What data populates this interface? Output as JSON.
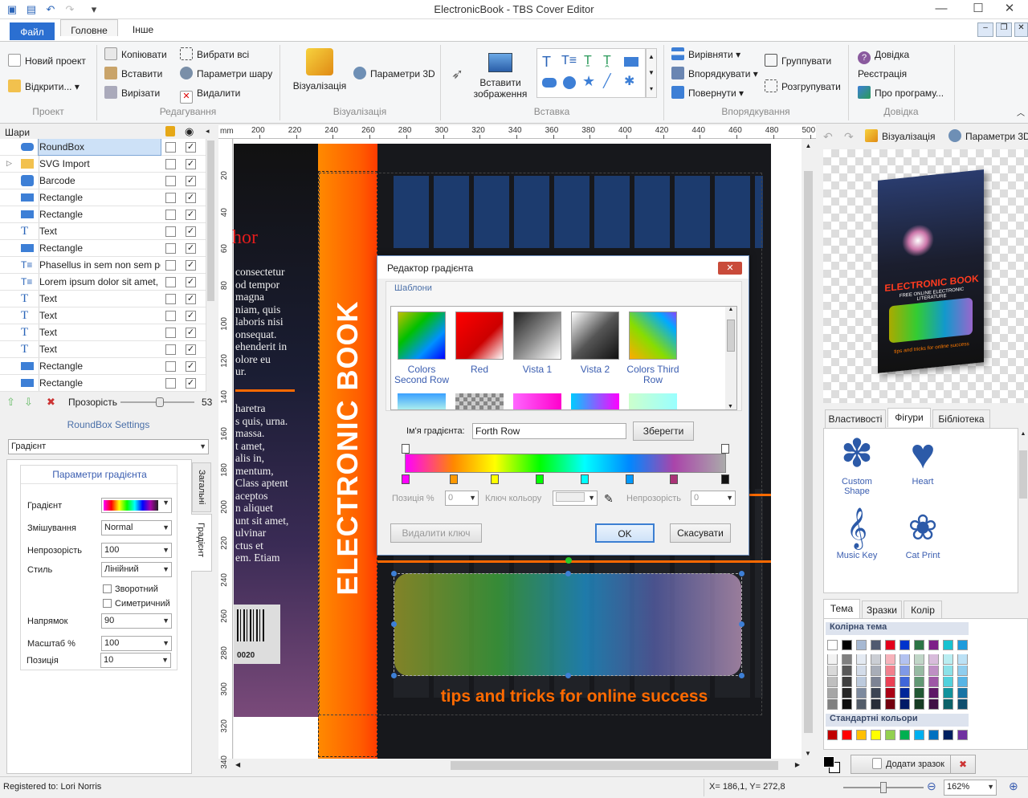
{
  "app": {
    "title": "ElectronicBook - TBS Cover Editor"
  },
  "ribbon_tabs": [
    "Файл",
    "Головне",
    "Інше"
  ],
  "ribbon": {
    "project": {
      "label": "Проект",
      "new": "Новий проект",
      "open": "Відкрити..."
    },
    "edit": {
      "label": "Редагування",
      "copy": "Копіювати",
      "paste": "Вставити",
      "cut": "Вирізати",
      "select_all": "Вибрати всі",
      "layer_params": "Параметри шару",
      "delete": "Видалити"
    },
    "visual": {
      "label": "Візуалізація",
      "visualize": "Візуалізація",
      "params3d": "Параметри 3D"
    },
    "insert": {
      "label": "Вставка",
      "insert_image": "Вставити зображення"
    },
    "arrange": {
      "label": "Впорядкування",
      "align": "Вирівняти",
      "order": "Впорядкувати",
      "rotate": "Повернути",
      "group": "Группувати",
      "ungroup": "Розгрупувати"
    },
    "help": {
      "label": "Довідка",
      "help": "Довідка",
      "register": "Реєстрація",
      "about": "Про програму..."
    }
  },
  "layers": {
    "title": "Шари",
    "items": [
      {
        "name": "RoundBox",
        "icon": "roundbox-icon",
        "selected": true
      },
      {
        "name": "SVG Import",
        "icon": "folder-icon",
        "selected": false
      },
      {
        "name": "Barcode",
        "icon": "puzzle-icon",
        "selected": false
      },
      {
        "name": "Rectangle",
        "icon": "rectangle-icon",
        "selected": false
      },
      {
        "name": "Rectangle",
        "icon": "rectangle-icon",
        "selected": false
      },
      {
        "name": "Text",
        "icon": "text-icon",
        "selected": false
      },
      {
        "name": "Rectangle",
        "icon": "rectangle-icon",
        "selected": false
      },
      {
        "name": "Phasellus in sem non sem porta",
        "icon": "paragraph-icon",
        "selected": false
      },
      {
        "name": "Lorem ipsum dolor sit amet, cor",
        "icon": "paragraph-icon",
        "selected": false
      },
      {
        "name": "Text",
        "icon": "text-icon",
        "selected": false
      },
      {
        "name": "Text",
        "icon": "text-icon",
        "selected": false
      },
      {
        "name": "Text",
        "icon": "text-icon",
        "selected": false
      },
      {
        "name": "Text",
        "icon": "text-icon",
        "selected": false
      },
      {
        "name": "Rectangle",
        "icon": "rectangle-icon",
        "selected": false
      },
      {
        "name": "Rectangle",
        "icon": "rectangle-icon",
        "selected": false
      }
    ],
    "opacity_label": "Прозорість",
    "opacity_value": "53",
    "opacity_level": 0.53
  },
  "settings": {
    "title": "RoundBox Settings",
    "fill_type": "Градієнт",
    "group_title": "Параметри градієнта",
    "gradient_label": "Градієнт",
    "blend_label": "Змішування",
    "blend_value": "Normal",
    "opacity_label": "Непрозорість",
    "opacity_value": "100",
    "style_label": "Стиль",
    "style_value": "Лінійний",
    "reverse_label": "Зворотний",
    "symmetric_label": "Симетричний",
    "direction_label": "Напрямок",
    "direction_value": "90",
    "scale_label": "Масштаб %",
    "scale_value": "100",
    "position_label": "Позиція",
    "position_value": "10",
    "side_tabs": [
      "Загальні",
      "Градієнт"
    ]
  },
  "ruler": {
    "unit": "mm",
    "top_ticks": [
      "200",
      "220",
      "240",
      "260",
      "280",
      "300",
      "320",
      "340",
      "360",
      "380",
      "400",
      "420",
      "440",
      "460",
      "480",
      "500"
    ],
    "left_ticks": [
      "20",
      "40",
      "60",
      "80",
      "100",
      "120",
      "140",
      "160",
      "180",
      "200",
      "220",
      "240",
      "260",
      "280",
      "300",
      "320",
      "340"
    ]
  },
  "cover": {
    "spine_title": "ELECTRONIC BOOK",
    "author_fragment": "hor",
    "body_text": [
      "consectetur",
      "od tempor",
      "magna",
      "niam, quis",
      "laboris nisi",
      "onsequat.",
      "ehenderit in",
      "olore eu",
      "ur."
    ],
    "body_text2": [
      "haretra",
      "s quis, urna.",
      "massa.",
      "t amet,",
      "alis in,",
      "mentum,",
      "Class aptent",
      "aceptos",
      "n aliquet",
      "unt sit amet,",
      "ulvinar",
      "ctus et",
      "em. Etiam"
    ],
    "barcode_number": "0020",
    "tagline": "tips and tricks for online success"
  },
  "dialog": {
    "title": "Редактор градієнта",
    "templates_label": "Шаблони",
    "templates": [
      {
        "name": "Colors Second Row"
      },
      {
        "name": "Red"
      },
      {
        "name": "Vista 1"
      },
      {
        "name": "Vista 2"
      },
      {
        "name": "Colors Third Row"
      }
    ],
    "name_label": "Ім'я градієнта:",
    "name_value": "Forth Row",
    "save": "Зберегти",
    "position_label": "Позиція %",
    "position_value": "0",
    "key_color_label": "Ключ кольору",
    "opacity_label": "Непрозорість",
    "opacity_value": "0",
    "delete_key": "Видалити ключ",
    "ok": "OK",
    "cancel": "Скасувати"
  },
  "right_panel": {
    "preview_tabs": [
      "Візуалізація",
      "Параметри 3D"
    ],
    "mini_book": {
      "title": "ELECTRONIC BOOK",
      "subtitle": "FREE ONLINE ELECTRONIC LITERATURE",
      "tagline": "tips and tricks for online success"
    },
    "tabs": [
      "Властивості",
      "Фігури",
      "Бібліотека"
    ],
    "active_tab": "Фігури",
    "shapes": [
      {
        "label": "Custom Shape",
        "icon": "custom-shape-icon"
      },
      {
        "label": "Heart",
        "icon": "heart-icon"
      },
      {
        "label": "Music Key",
        "icon": "music-key-icon"
      },
      {
        "label": "Cat Print",
        "icon": "cat-print-icon"
      }
    ],
    "color_tabs": [
      "Тема",
      "Зразки",
      "Колір"
    ],
    "theme_colors_label": "Колірна тема",
    "standard_colors_label": "Стандартні кольори",
    "theme_colors": [
      "#ffffff",
      "#000000",
      "#a6b8d2",
      "#505a70",
      "#e3001b",
      "#0033cc",
      "#2c7545",
      "#7d1f88",
      "#17c2d0",
      "#1f9bdc"
    ],
    "standard_colors": [
      "#c00000",
      "#ff0000",
      "#ffc000",
      "#ffff00",
      "#92d050",
      "#00b050",
      "#00b0f0",
      "#0070c0",
      "#002060",
      "#7030a0"
    ],
    "add_sample": "Додати зразок"
  },
  "status": {
    "registered": "Registered to: Lori Norris",
    "coords": "X= 186,1, Y= 272,8",
    "zoom": "162%"
  }
}
